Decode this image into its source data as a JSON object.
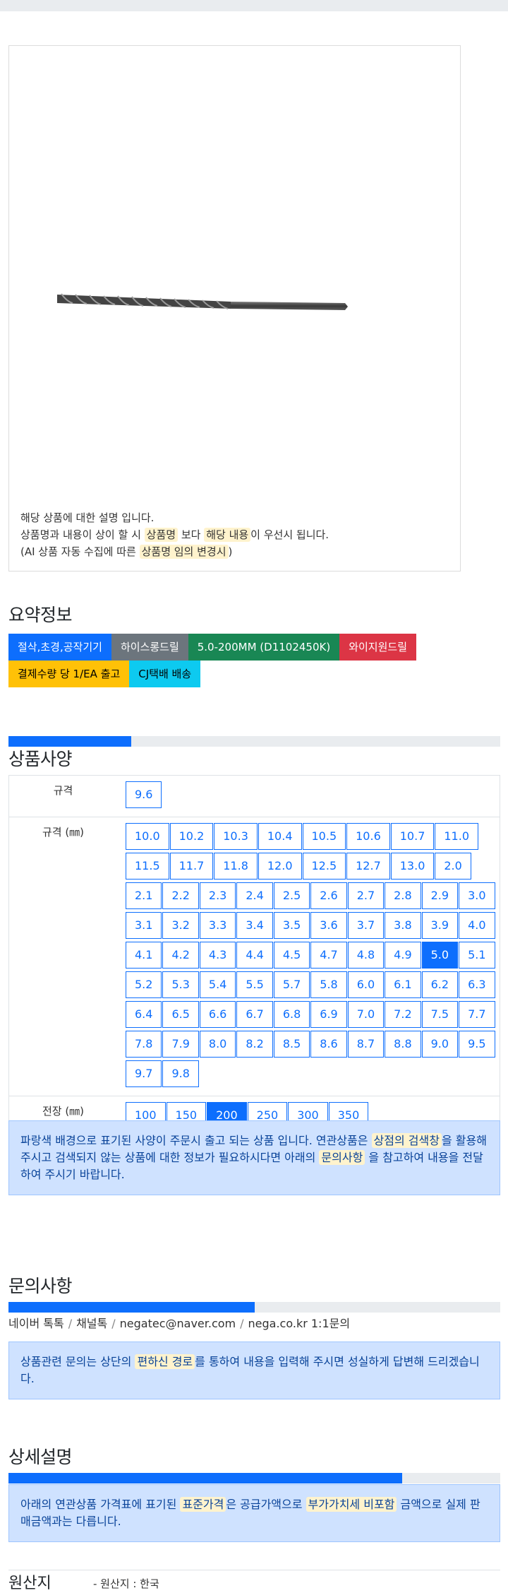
{
  "product": {
    "image_icon": "drill-bit-image",
    "desc_line1": "해당 상품에 대한 설명 입니다.",
    "desc_line2_pre": "상품명과 내용이 상이 할 시 ",
    "desc_line2_hl1": "상품명",
    "desc_line2_mid": " 보다 ",
    "desc_line2_hl2": "해당 내용",
    "desc_line2_post": "이 우선시 됩니다.",
    "desc_line3_pre": "(AI 상품 자동 수집에 따른 ",
    "desc_line3_hl": "상품명 임의 변경시",
    "desc_line3_post": ")"
  },
  "summary": {
    "title": "요약정보",
    "badges_row1": [
      {
        "label": "절삭,초경,공작기기",
        "color": "#0d6efd"
      },
      {
        "label": "하이스롱드릴",
        "color": "#6c757d"
      },
      {
        "label": "5.0-200MM (D1102450K)",
        "color": "#198754"
      },
      {
        "label": "와이지원드릴",
        "color": "#dc3545"
      }
    ],
    "badges_row2": [
      {
        "label": "결제수량 당 1/EA 출고",
        "color": "#ffc107"
      },
      {
        "label": "CJ택배 배송",
        "color": "#0dcaf0"
      }
    ]
  },
  "spec": {
    "title": "상품사양",
    "progress": 0.25,
    "rows": [
      {
        "label": "규격",
        "options": [
          "9.6"
        ],
        "active": ""
      },
      {
        "label": "규격 (㎜)",
        "options": [
          "10.0",
          "10.2",
          "10.3",
          "10.4",
          "10.5",
          "10.6",
          "10.7",
          "11.0",
          "11.5",
          "11.7",
          "11.8",
          "12.0",
          "12.5",
          "12.7",
          "13.0",
          "2.0",
          "2.1",
          "2.2",
          "2.3",
          "2.4",
          "2.5",
          "2.6",
          "2.7",
          "2.8",
          "2.9",
          "3.0",
          "3.1",
          "3.2",
          "3.3",
          "3.4",
          "3.5",
          "3.6",
          "3.7",
          "3.8",
          "3.9",
          "4.0",
          "4.1",
          "4.2",
          "4.3",
          "4.4",
          "4.5",
          "4.7",
          "4.8",
          "4.9",
          "5.0",
          "5.1",
          "5.2",
          "5.3",
          "5.4",
          "5.5",
          "5.7",
          "5.8",
          "6.0",
          "6.1",
          "6.2",
          "6.3",
          "6.4",
          "6.5",
          "6.6",
          "6.7",
          "6.8",
          "6.9",
          "7.0",
          "7.2",
          "7.5",
          "7.7",
          "7.8",
          "7.9",
          "8.0",
          "8.2",
          "8.5",
          "8.6",
          "8.7",
          "8.8",
          "9.0",
          "9.5",
          "9.7",
          "9.8"
        ],
        "active": "5.0"
      },
      {
        "label": "전장 (㎜)",
        "options": [
          "100",
          "150",
          "200",
          "250",
          "300",
          "350"
        ],
        "active": "200"
      }
    ],
    "note_pre": "파랑색 배경으로 표기된 사양이 주문시 출고 되는 상품 입니다. 연관상품은 ",
    "note_hl1": "상점의 검색창",
    "note_mid": "을 활용해 주시고 검색되지 않는 상품에 대한 정보가 필요하시다면 아래의 ",
    "note_hl2": "문의사항",
    "note_post": " 을 참고하여 내용을 전달하여 주시기 바랍니다."
  },
  "inquiry": {
    "title": "문의사항",
    "progress": 0.5,
    "contacts": [
      "네이버 톡톡",
      "채널톡",
      "negatec@naver.com",
      "nega.co.kr 1:1문의"
    ],
    "note_pre": "상품관련 문의는 상단의 ",
    "note_hl": "편하신 경로",
    "note_post": "를 통하여 내용을 입력해 주시면 성실하게 답변해 드리겠습니다."
  },
  "detail": {
    "title": "상세설명",
    "progress": 0.8,
    "note_pre": "아래의 연관상품 가격표에 표기된 ",
    "note_hl1": "표준가격",
    "note_mid": "은 공급가액으로 ",
    "note_hl2": "부가가치세 비포함",
    "note_post": " 금액으로 실제 판매금액과는 다릅니다."
  },
  "origin": {
    "title": "원산지",
    "value": "- 원산지 : 한국"
  }
}
